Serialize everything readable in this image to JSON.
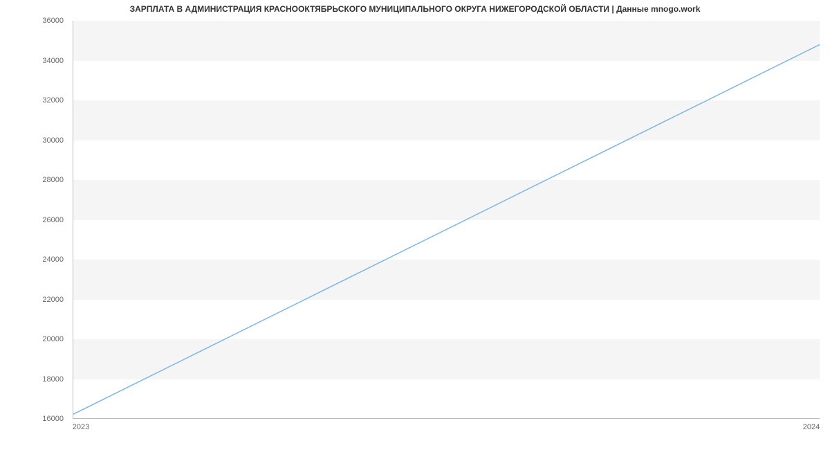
{
  "chart_data": {
    "type": "line",
    "title": "ЗАРПЛАТА В АДМИНИСТРАЦИЯ КРАСНООКТЯБРЬСКОГО МУНИЦИПАЛЬНОГО ОКРУГА НИЖЕГОРОДСКОЙ ОБЛАСТИ | Данные mnogo.work",
    "x": [
      2023,
      2024
    ],
    "values": [
      16200,
      34800
    ],
    "y_ticks": [
      16000,
      18000,
      20000,
      22000,
      24000,
      26000,
      28000,
      30000,
      32000,
      34000,
      36000
    ],
    "x_ticks": [
      2023,
      2024
    ],
    "xlabel": "",
    "ylabel": "",
    "xlim": [
      2023,
      2024
    ],
    "ylim": [
      16000,
      36000
    ],
    "line_color": "#7cb5ec",
    "grid": "alternating-bands"
  }
}
